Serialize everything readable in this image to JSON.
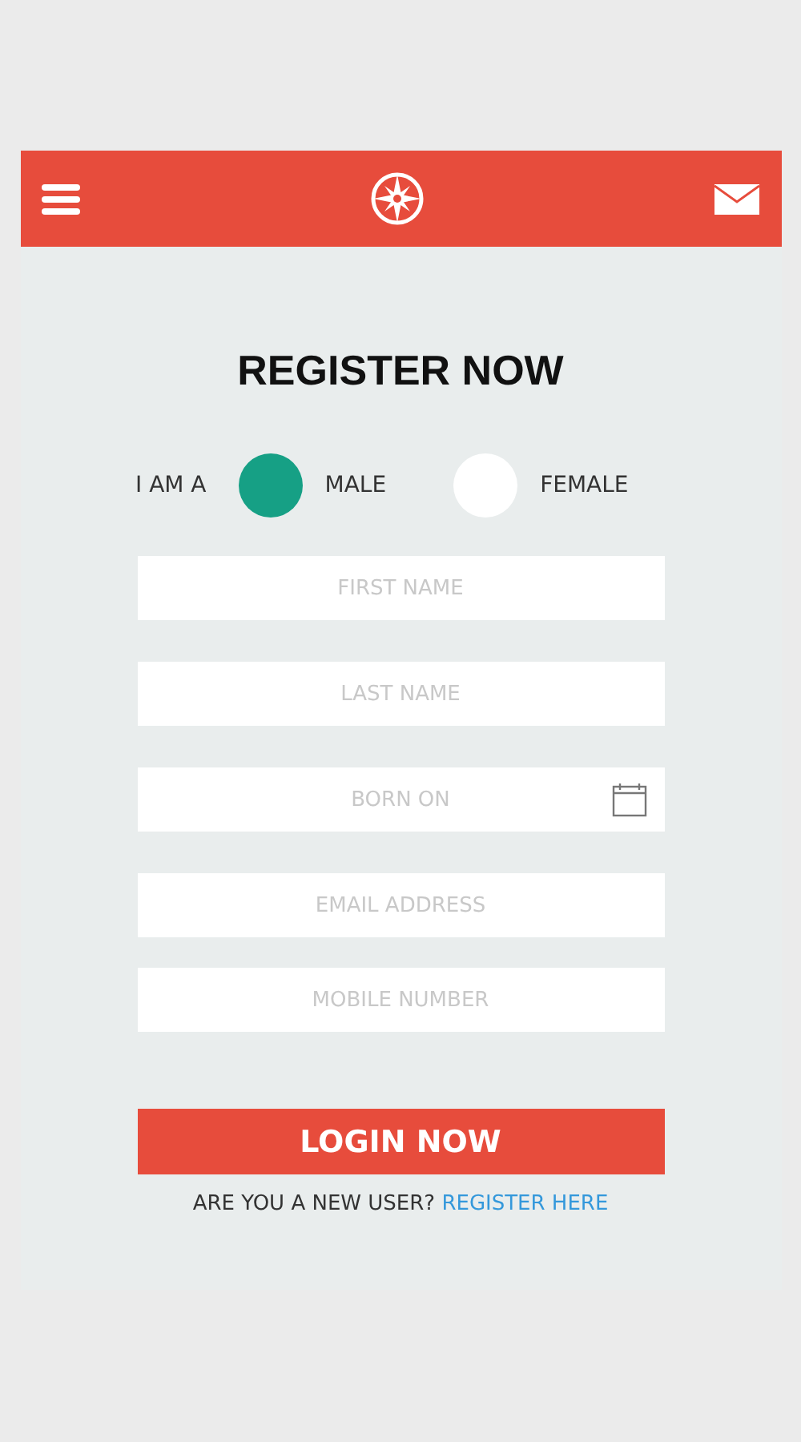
{
  "title": "REGISTER NOW",
  "gender": {
    "label": "I AM A",
    "options": [
      {
        "label": "MALE",
        "selected": true
      },
      {
        "label": "FEMALE",
        "selected": false
      }
    ]
  },
  "fields": [
    {
      "placeholder": "FIRST NAME",
      "kind": "text"
    },
    {
      "placeholder": "LAST NAME",
      "kind": "text"
    },
    {
      "placeholder": "BORN ON",
      "kind": "date"
    },
    {
      "placeholder": "EMAIL ADDRESS",
      "kind": "text"
    },
    {
      "placeholder": "MOBILE NUMBER",
      "kind": "text"
    }
  ],
  "submit": "LOGIN NOW",
  "footer": {
    "question": "ARE YOU A NEW USER?",
    "link": "REGISTER HERE"
  }
}
